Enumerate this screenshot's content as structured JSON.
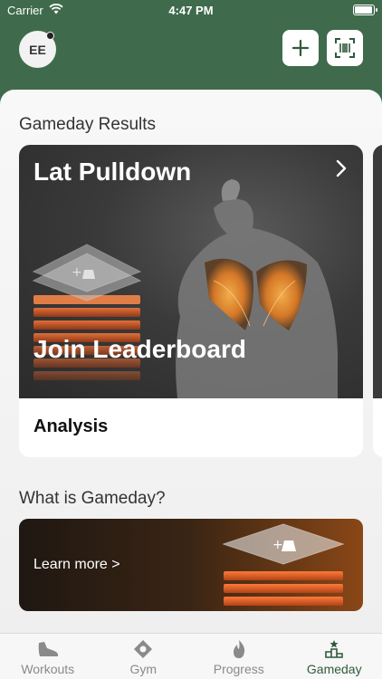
{
  "status_bar": {
    "carrier": "Carrier",
    "time": "4:47 PM",
    "battery_level": 0.95
  },
  "header": {
    "avatar_initials": "EE"
  },
  "gameday_results": {
    "title": "Gameday Results",
    "card": {
      "exercise": "Lat Pulldown",
      "cta": "Join Leaderboard",
      "footer": "Analysis"
    }
  },
  "what_is_gameday": {
    "title": "What is Gameday?",
    "link": "Learn more >"
  },
  "tabs": [
    {
      "label": "Workouts",
      "icon": "shoe-icon"
    },
    {
      "label": "Gym",
      "icon": "location-icon"
    },
    {
      "label": "Progress",
      "icon": "flame-icon"
    },
    {
      "label": "Gameday",
      "icon": "podium-icon",
      "active": true
    }
  ],
  "colors": {
    "header_green": "#3f6b4c",
    "accent_orange": "#e8642a",
    "active_tab": "#2f5a3c"
  }
}
